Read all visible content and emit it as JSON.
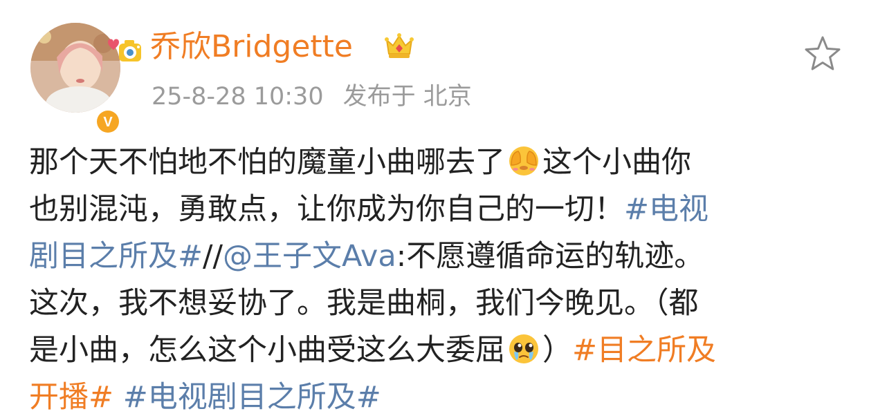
{
  "user": {
    "name": "乔欣Bridgette",
    "verified_badge_letter": "V"
  },
  "meta": {
    "timestamp": "25-8-28 10:30",
    "location": "发布于 北京"
  },
  "colors": {
    "username": "#f07d24",
    "link_blue": "#5b7eaa",
    "topic_orange": "#f07d24",
    "meta_gray": "#9b9b9b",
    "text": "#222222"
  },
  "icons": {
    "favorite": "star-outline-icon",
    "crown": "crown-icon",
    "emoji_1": "shy-cover-face-emoji",
    "emoji_2": "pleading-tearful-emoji"
  },
  "post": {
    "l1_a": "那个天不怕地不怕的魔童小曲哪去了",
    "l1_b": "这个小曲你",
    "l2_a": "也别混沌，勇敢点，让你成为你自己的一切！",
    "l2_hashtag": "#电视",
    "l3_hashtag": "剧目之所及#",
    "l3_sep": "//",
    "l3_mention": "@王子文Ava",
    "l3_text": ":不愿遵循命运的轨迹。",
    "l4_text": "这次，我不想妥协了。我是曲桐，我们今晚见。（都",
    "l5_a": "是小曲，怎么这个小曲受这么大委屈",
    "l5_b": "）",
    "l5_topic": "#目之所及",
    "l6_topic": "开播#",
    "l6_hashtag": "#电视剧目之所及#"
  }
}
